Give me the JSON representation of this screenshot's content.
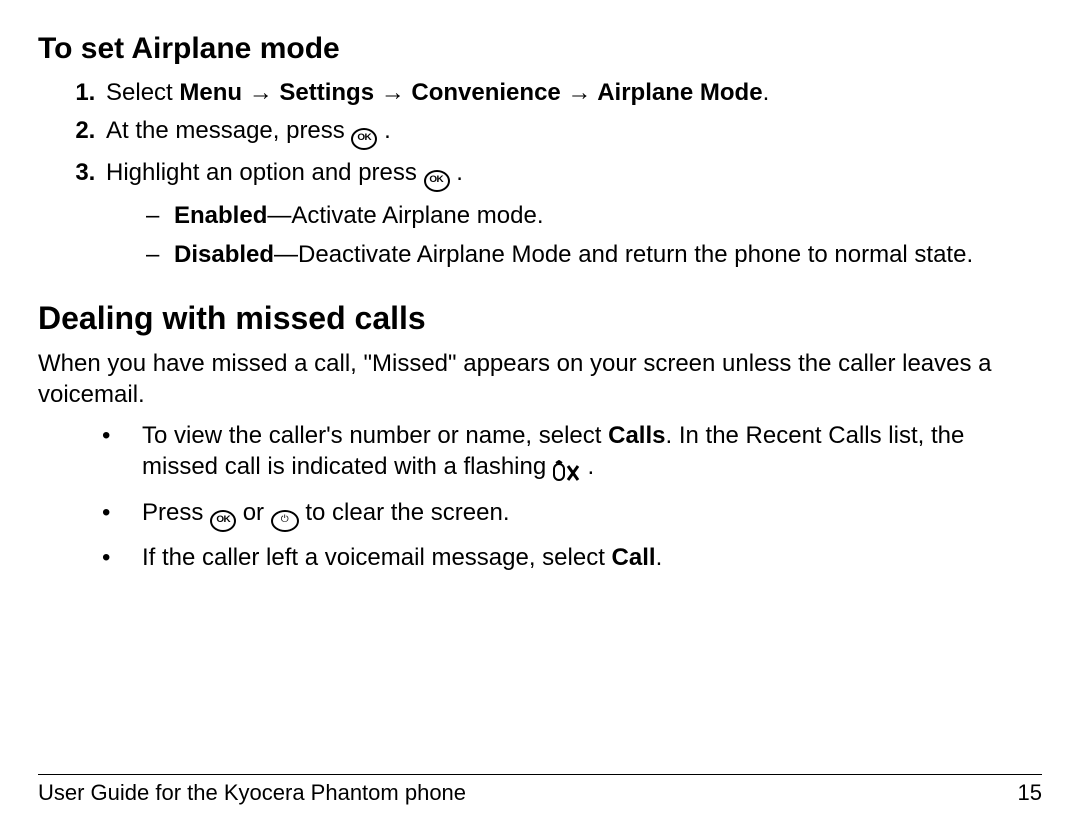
{
  "section1": {
    "heading": "To set Airplane mode",
    "step1": {
      "pre": "Select ",
      "path": "Menu → Settings → Convenience → Airplane Mode",
      "post": "."
    },
    "step2": {
      "pre": "At the message, press ",
      "post": " ."
    },
    "step3": {
      "pre": "Highlight an option and press ",
      "post": " ."
    },
    "opt1": {
      "label": "Enabled",
      "desc": "—Activate Airplane mode."
    },
    "opt2": {
      "label": "Disabled",
      "desc": "—Deactivate Airplane Mode and return the phone to normal state."
    }
  },
  "section2": {
    "heading": "Dealing with missed calls",
    "para": "When you have missed a call, \"Missed\" appears on your screen unless the caller leaves a voicemail.",
    "b1": {
      "pre": "To view the caller's number or name, select ",
      "calls": "Calls",
      "mid": ". In the Recent Calls list, the missed call is indicated with a flashing ",
      "post": " ."
    },
    "b2": {
      "pre": "Press ",
      "mid": " or ",
      "post": " to clear the screen."
    },
    "b3": {
      "pre": "If the caller left a voicemail message, select ",
      "call": "Call",
      "post": "."
    }
  },
  "footer": {
    "left": "User Guide for the Kyocera Phantom phone",
    "right": "15"
  }
}
